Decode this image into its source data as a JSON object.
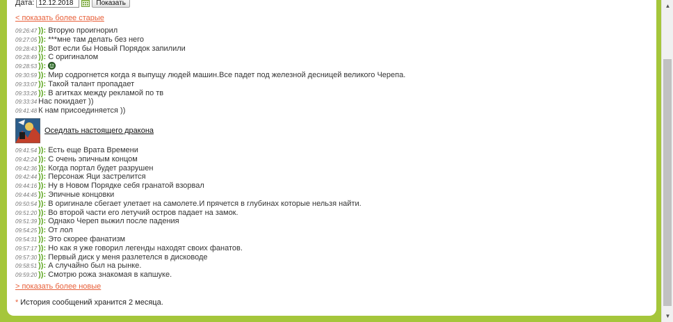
{
  "date_filter": {
    "label": "Дата:",
    "value": "12.12.2018",
    "show_button": "Показать"
  },
  "older_link": "< показать более старые",
  "newer_link": "> показать более новые",
  "nick": ")):",
  "messages_a": [
    {
      "time": "09:26:47",
      "nick": true,
      "text": "Вторую проигнорил"
    },
    {
      "time": "09:27:05",
      "nick": true,
      "text": "***мне там делать без него"
    },
    {
      "time": "09:28:43",
      "nick": true,
      "text": "Вот если бы Новый Порядок запилили"
    },
    {
      "time": "09:28:49",
      "nick": true,
      "text": "С оригиналом"
    },
    {
      "time": "09:28:53",
      "nick": true,
      "text": "",
      "emoji": true
    },
    {
      "time": "09:30:59",
      "nick": true,
      "text": "Мир содрогнется когда я выпущу людей машин.Все падет под железной десницей великого Черепа."
    },
    {
      "time": "09:33:07",
      "nick": true,
      "text": "Такой талант пропадает"
    },
    {
      "time": "09:33:26",
      "nick": true,
      "text": "В агитках между рекламой по тв"
    },
    {
      "time": "09:33:34",
      "nick": false,
      "text": "Нас покидает ))"
    },
    {
      "time": "09:41:48",
      "nick": false,
      "text": "К нам присоединяется ))"
    }
  ],
  "topic": {
    "title": "Оседлать настоящего дракона"
  },
  "messages_b": [
    {
      "time": "09:41:54",
      "nick": true,
      "text": "Есть еще Врата Времени"
    },
    {
      "time": "09:42:24",
      "nick": true,
      "text": "С очень эпичным концом"
    },
    {
      "time": "09:42:36",
      "nick": true,
      "text": "Когда портал будет разрушен"
    },
    {
      "time": "09:42:44",
      "nick": true,
      "text": "Персонаж Яци застрелится"
    },
    {
      "time": "09:44:16",
      "nick": true,
      "text": "Ну в Новом Порядке себя гранатой взорвал"
    },
    {
      "time": "09:44:45",
      "nick": true,
      "text": "Эпичные концовки"
    },
    {
      "time": "09:50:54",
      "nick": true,
      "text": "В оригинале сбегает улетает на самолете.И прячется в глубинах которые нельзя найти."
    },
    {
      "time": "09:51:20",
      "nick": true,
      "text": "Во второй части его летучий остров падает на замок."
    },
    {
      "time": "09:51:39",
      "nick": true,
      "text": "Однако Череп выжил после падения"
    },
    {
      "time": "09:54:25",
      "nick": true,
      "text": "От лол"
    },
    {
      "time": "09:54:31",
      "nick": true,
      "text": "Это скорее фанатизм"
    },
    {
      "time": "09:57:17",
      "nick": true,
      "text": "Но как я уже говорил легенды находят своих фанатов."
    },
    {
      "time": "09:57:30",
      "nick": true,
      "text": "Первый диск у меня разлетелся в дисководе"
    },
    {
      "time": "09:58:51",
      "nick": true,
      "text": "А случайно был на рынке."
    },
    {
      "time": "09:59:20",
      "nick": true,
      "text": "Смотрю рожа знакомая в капшуке."
    }
  ],
  "note": {
    "star": "*",
    "text": "История сообщений хранится 2 месяца."
  },
  "colors": {
    "background": "#a5c63b",
    "link": "#e8603a",
    "nick": "#5aa51a"
  }
}
